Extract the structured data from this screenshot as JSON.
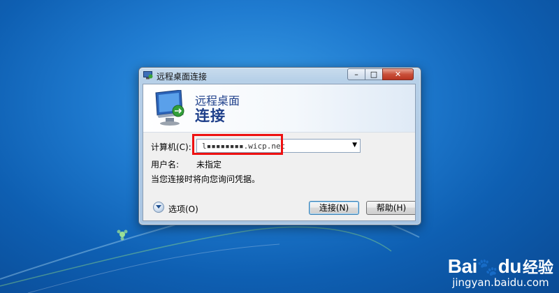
{
  "window": {
    "title": "远程桌面连接",
    "minimize_glyph": "–",
    "maximize_glyph": "□",
    "close_glyph": "✕"
  },
  "banner": {
    "line1": "远程桌面",
    "line2": "连接"
  },
  "form": {
    "computer_label": "计算机(C):",
    "computer_value": "l▪▪▪▪▪▪▪▪.wicp.net",
    "username_label": "用户名:",
    "username_value": "未指定",
    "hint": "当您连接时将向您询问凭据。"
  },
  "footer": {
    "options_label": "选项(O)",
    "connect_label": "连接(N)",
    "help_label": "帮助(H)"
  },
  "watermark": {
    "logo_text": "Bai",
    "logo_text_tail": "du",
    "cn_text": "经验",
    "url": "jingyan.baidu.com"
  },
  "colors": {
    "highlight_box": "#ee1111",
    "desktop_blue": "#1f7bd0",
    "banner_text": "#1e3f8a"
  }
}
